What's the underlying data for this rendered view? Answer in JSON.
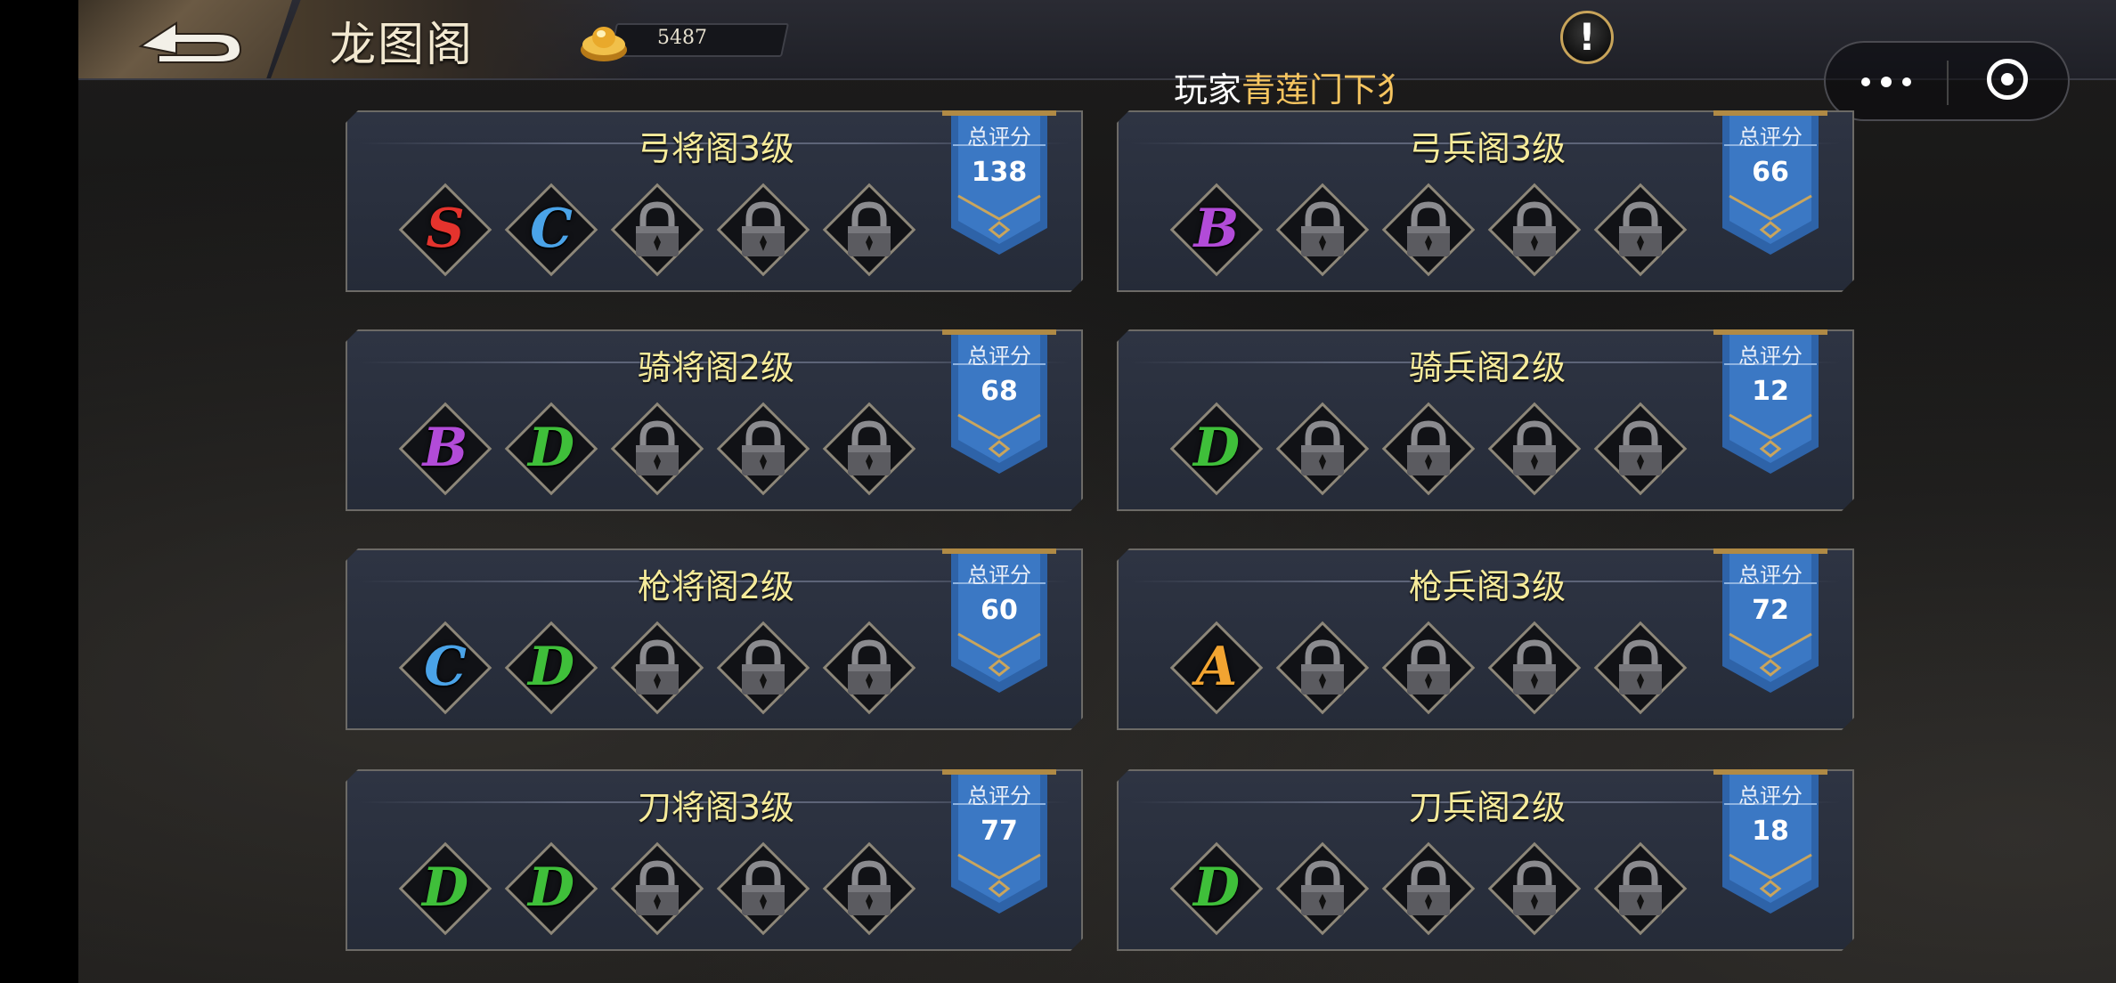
{
  "header": {
    "title": "龙图阁",
    "currency_value": "5487",
    "marquee_prefix": "玩家",
    "marquee_highlight": "青莲门下犭"
  },
  "colors": {
    "title_yellow": "#f6eb9a",
    "grade_S": "#e4332d",
    "grade_A": "#f2a431",
    "grade_B": "#b24bd8",
    "grade_C": "#4aa3e8",
    "grade_D": "#3fbf3a",
    "banner_blue": "#2e63a8"
  },
  "banner_label": "总评分",
  "panels": [
    {
      "title": "弓将阁3级",
      "score": "138",
      "slots": [
        "S",
        "C",
        "locked",
        "locked",
        "locked"
      ]
    },
    {
      "title": "弓兵阁3级",
      "score": "66",
      "slots": [
        "B",
        "locked",
        "locked",
        "locked",
        "locked"
      ]
    },
    {
      "title": "骑将阁2级",
      "score": "68",
      "slots": [
        "B",
        "D",
        "locked",
        "locked",
        "locked"
      ]
    },
    {
      "title": "骑兵阁2级",
      "score": "12",
      "slots": [
        "D",
        "locked",
        "locked",
        "locked",
        "locked"
      ]
    },
    {
      "title": "枪将阁2级",
      "score": "60",
      "slots": [
        "C",
        "D",
        "locked",
        "locked",
        "locked"
      ]
    },
    {
      "title": "枪兵阁3级",
      "score": "72",
      "slots": [
        "A",
        "locked",
        "locked",
        "locked",
        "locked"
      ]
    },
    {
      "title": "刀将阁3级",
      "score": "77",
      "slots": [
        "D",
        "D",
        "locked",
        "locked",
        "locked"
      ]
    },
    {
      "title": "刀兵阁2级",
      "score": "18",
      "slots": [
        "D",
        "locked",
        "locked",
        "locked",
        "locked"
      ]
    }
  ]
}
